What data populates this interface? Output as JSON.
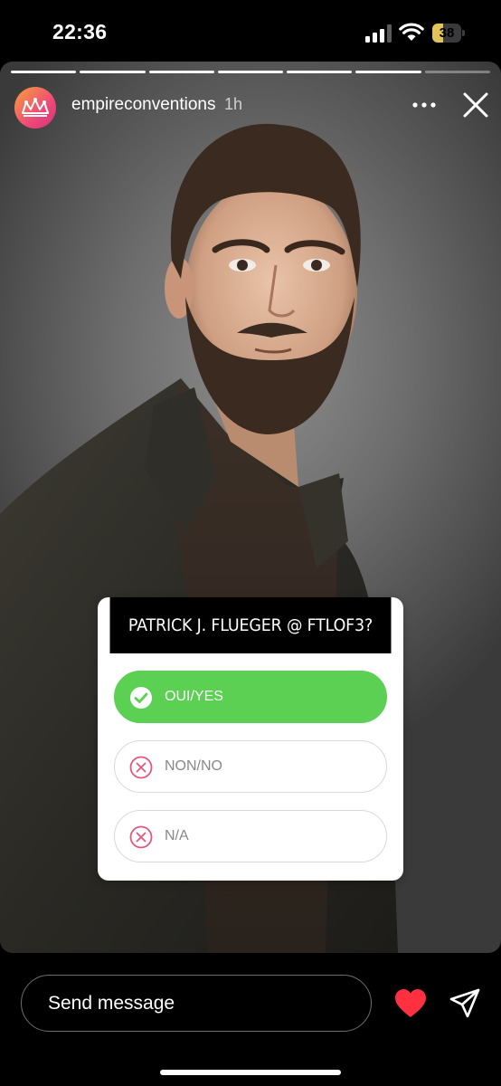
{
  "status_bar": {
    "time": "22:36",
    "battery_percent": "38",
    "battery_level": 0.38
  },
  "story": {
    "progress": {
      "segments": 7,
      "completed": 6
    },
    "account": "empireconventions",
    "time_ago": "1h",
    "icons": {
      "more": "more-horizontal-icon",
      "close": "close-icon"
    }
  },
  "poll": {
    "question": "PATRICK J. FLUEGER @ FTLOF3?",
    "options": [
      {
        "label": "OUI/YES",
        "selected": true,
        "icon": "check-circle-icon"
      },
      {
        "label": "NON/NO",
        "selected": false,
        "icon": "x-circle-icon"
      },
      {
        "label": "N/A",
        "selected": false,
        "icon": "x-circle-icon"
      }
    ],
    "colors": {
      "selected": "#5bd052",
      "unselected_icon": "#e8567a"
    }
  },
  "footer": {
    "message_placeholder": "Send message",
    "icons": {
      "like": "heart-icon",
      "share": "send-icon"
    },
    "colors": {
      "heart": "#ff3040"
    }
  }
}
